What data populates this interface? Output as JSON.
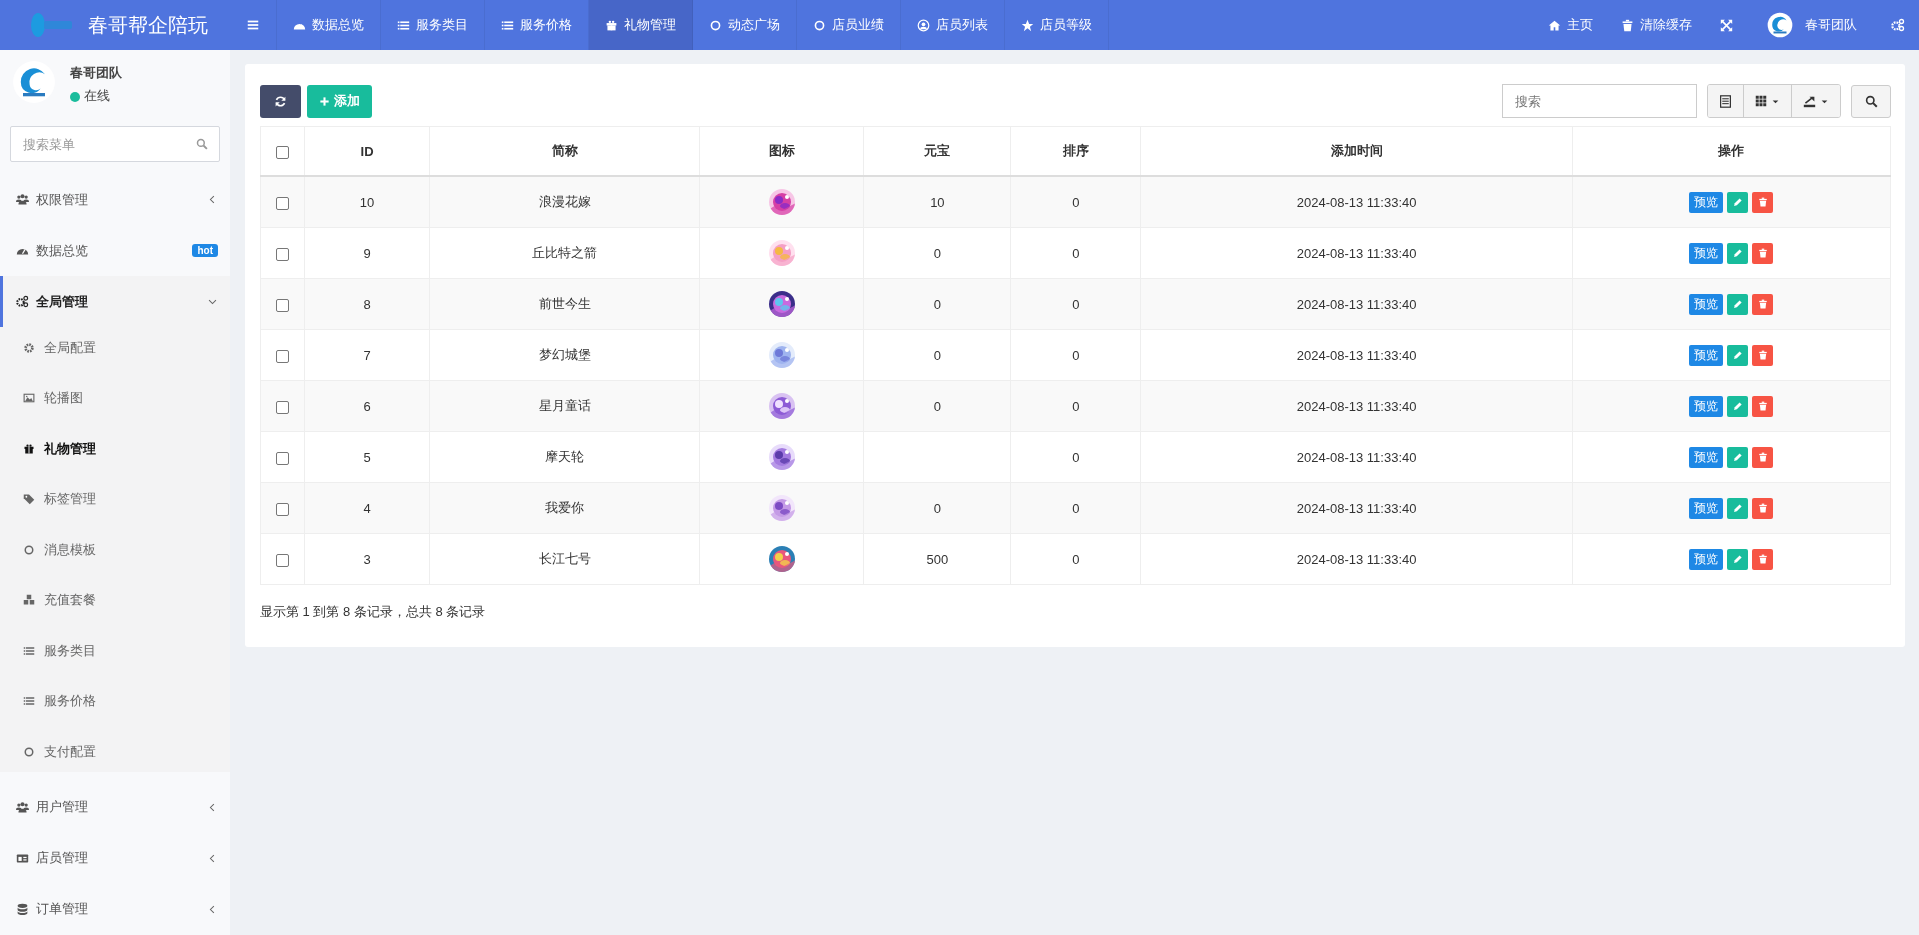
{
  "brand": {
    "title": "春哥帮企陪玩"
  },
  "top_nav": [
    {
      "label": "数据总览",
      "selected": false
    },
    {
      "label": "服务类目",
      "selected": false
    },
    {
      "label": "服务价格",
      "selected": false
    },
    {
      "label": "礼物管理",
      "selected": true
    },
    {
      "label": "动态广场",
      "selected": false
    },
    {
      "label": "店员业绩",
      "selected": false
    },
    {
      "label": "店员列表",
      "selected": false
    },
    {
      "label": "店员等级",
      "selected": false
    }
  ],
  "top_right": {
    "home": "主页",
    "clear_cache": "清除缓存",
    "user": "春哥团队"
  },
  "profile": {
    "name": "春哥团队",
    "status": "在线"
  },
  "sidebar_search": {
    "placeholder": "搜索菜单"
  },
  "sidebar": {
    "items": [
      {
        "label": "权限管理",
        "selected": false,
        "expanded": false
      },
      {
        "label": "数据总览",
        "selected": false,
        "badge": "hot"
      },
      {
        "label": "全局管理",
        "selected": true,
        "expanded": true,
        "children": [
          {
            "label": "全局配置",
            "selected": false
          },
          {
            "label": "轮播图",
            "selected": false
          },
          {
            "label": "礼物管理",
            "selected": true
          },
          {
            "label": "标签管理",
            "selected": false
          },
          {
            "label": "消息模板",
            "selected": false
          },
          {
            "label": "充值套餐",
            "selected": false
          },
          {
            "label": "服务类目",
            "selected": false
          },
          {
            "label": "服务价格",
            "selected": false
          },
          {
            "label": "支付配置",
            "selected": false
          }
        ]
      },
      {
        "label": "用户管理",
        "selected": false,
        "expanded": false
      },
      {
        "label": "店员管理",
        "selected": false,
        "expanded": false
      },
      {
        "label": "订单管理",
        "selected": false,
        "expanded": false
      }
    ]
  },
  "toolbar": {
    "add": "添加",
    "search_placeholder": "搜索"
  },
  "table": {
    "columns": [
      "ID",
      "简称",
      "图标",
      "元宝",
      "排序",
      "添加时间",
      "操作"
    ],
    "header_checked": false,
    "rows": [
      {
        "checked": false,
        "id": "10",
        "name": "浪漫花嫁",
        "yuanbao": "10",
        "sort": "0",
        "time": "2024-08-13 11:33:40",
        "preview": "预览"
      },
      {
        "checked": false,
        "id": "9",
        "name": "丘比特之箭",
        "yuanbao": "0",
        "sort": "0",
        "time": "2024-08-13 11:33:40",
        "preview": "预览"
      },
      {
        "checked": false,
        "id": "8",
        "name": "前世今生",
        "yuanbao": "0",
        "sort": "0",
        "time": "2024-08-13 11:33:40",
        "preview": "预览"
      },
      {
        "checked": false,
        "id": "7",
        "name": "梦幻城堡",
        "yuanbao": "0",
        "sort": "0",
        "time": "2024-08-13 11:33:40",
        "preview": "预览"
      },
      {
        "checked": false,
        "id": "6",
        "name": "星月童话",
        "yuanbao": "0",
        "sort": "0",
        "time": "2024-08-13 11:33:40",
        "preview": "预览"
      },
      {
        "checked": false,
        "id": "5",
        "name": "摩天轮",
        "sort": "0",
        "time": "2024-08-13 11:33:40",
        "preview": "预览"
      },
      {
        "checked": false,
        "id": "4",
        "name": "我爱你",
        "yuanbao": "0",
        "sort": "0",
        "time": "2024-08-13 11:33:40",
        "preview": "预览"
      },
      {
        "checked": false,
        "id": "3",
        "name": "长江七号",
        "yuanbao": "500",
        "sort": "0",
        "time": "2024-08-13 11:33:40",
        "preview": "预览"
      }
    ],
    "summary": "显示第 1 到第 8 条记录，总共 8 条记录"
  }
}
